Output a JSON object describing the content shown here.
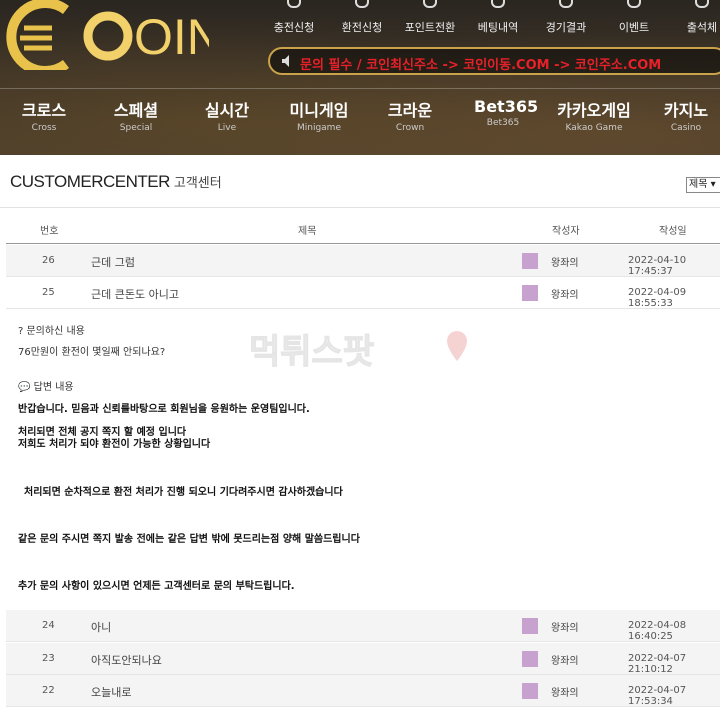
{
  "brand": {
    "logo_text": "OIN"
  },
  "top_menu": [
    {
      "label": "충전신청",
      "icon": "deposit-icon"
    },
    {
      "label": "환전신청",
      "icon": "withdraw-icon"
    },
    {
      "label": "포인트전환",
      "icon": "point-icon"
    },
    {
      "label": "베팅내역",
      "icon": "bet-history-icon"
    },
    {
      "label": "경기결과",
      "icon": "result-icon"
    },
    {
      "label": "이벤트",
      "icon": "event-icon"
    },
    {
      "label": "출석체",
      "icon": "attendance-icon"
    }
  ],
  "notice": {
    "text": "문의 필수 / 코인최신주소 -> 코인이동.COM -> 코인주소.COM"
  },
  "main_nav": [
    {
      "ko": "크로스",
      "en": "Cross"
    },
    {
      "ko": "스페셜",
      "en": "Special"
    },
    {
      "ko": "실시간",
      "en": "Live"
    },
    {
      "ko": "미니게임",
      "en": "Minigame"
    },
    {
      "ko": "크라운",
      "en": "Crown"
    },
    {
      "ko": "Bet365",
      "en": "Bet365"
    },
    {
      "ko": "카카오게임",
      "en": "Kakao Game"
    },
    {
      "ko": "카지노",
      "en": "Casino"
    }
  ],
  "page": {
    "title": "CUSTOMERCENTER",
    "subtitle": "고객센터",
    "search_option": "제목"
  },
  "table": {
    "headers": {
      "no": "번호",
      "title": "제목",
      "author": "작성자",
      "date": "작성일"
    },
    "rows_top": [
      {
        "no": "26",
        "title": "근데 그럼",
        "author": "왕좌의",
        "date": "2022-04-10 17:45:37"
      },
      {
        "no": "25",
        "title": "근데 큰돈도 아니고",
        "author": "왕좌의",
        "date": "2022-04-09 18:55:33"
      }
    ],
    "rows_bottom": [
      {
        "no": "24",
        "title": "아니",
        "author": "왕좌의",
        "date": "2022-04-08 16:40:25"
      },
      {
        "no": "23",
        "title": "아직도안되나요",
        "author": "왕좌의",
        "date": "2022-04-07 21:10:12"
      },
      {
        "no": "22",
        "title": "오늘내로",
        "author": "왕좌의",
        "date": "2022-04-07 17:53:34"
      }
    ]
  },
  "detail": {
    "question_heading": "? 문의하신 내용",
    "question_body": "76만원이 환전이 몇일째 안되나요?",
    "answer_heading": "답변 내용",
    "answer_lines": [
      "반갑습니다. 믿음과 신뢰를바탕으로 회원님을 응원하는 운영팀입니다.",
      "처리되면 전체 공지 쪽지 할 예정 입니다",
      "저희도 처리가 되야 환전이 가능한 상황입니다",
      "처리되면 순차적으로 환전 처리가 진행 되오니 기다려주시면 감사하겠습니다",
      "같은 문의 주시면 쪽지 발송 전에는 같은 답변 밖에 못드리는점 양해 말씀드립니다",
      "추가 문의 사항이 있으시면 언제든 고객센터로 문의 부탁드립니다."
    ]
  },
  "watermark": {
    "text": "먹튀스팟"
  },
  "colors": {
    "author_swatch": "#c7a2cf",
    "notice_text": "#e8202a",
    "logo_gold": "#e8c24a"
  }
}
